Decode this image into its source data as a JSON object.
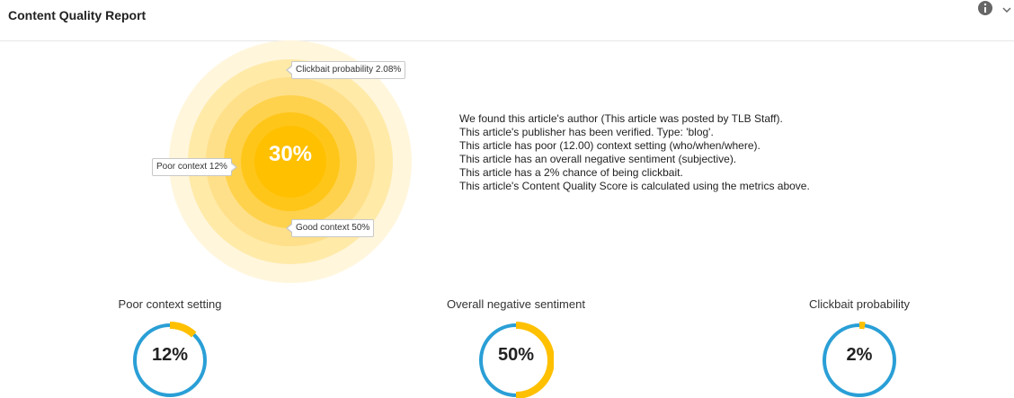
{
  "header": {
    "title": "Content Quality Report",
    "info_icon": "info-icon",
    "collapse_icon": "chevron-down-icon"
  },
  "score": {
    "value": "30%",
    "percent": 30,
    "callouts": {
      "clickbait": "Clickbait probability 2.08%",
      "poor_context": "Poor context 12%",
      "good_context": "Good context 50%"
    },
    "ring_colors": [
      "#fff6dc",
      "#ffeaa8",
      "#ffe08a",
      "#ffd24d",
      "#ffc61a",
      "#ffc000"
    ]
  },
  "summary": {
    "lines": [
      "We found this article's author (This article was posted by TLB Staff).",
      "This article's publisher has been verified. Type: 'blog'.",
      "This article has poor (12.00) context setting (who/when/where).",
      "This article has an overall negative sentiment (subjective).",
      "This article has a 2% chance of being clickbait.",
      "This article's Content Quality Score is calculated using the metrics above."
    ]
  },
  "metrics": [
    {
      "title": "Poor context setting",
      "value": "12%",
      "percent": 12
    },
    {
      "title": "Overall negative sentiment",
      "value": "50%",
      "percent": 50
    },
    {
      "title": "Clickbait probability",
      "value": "2%",
      "percent": 2
    }
  ],
  "colors": {
    "gauge_base": "#2a9fd6",
    "gauge_fill": "#ffc000"
  }
}
